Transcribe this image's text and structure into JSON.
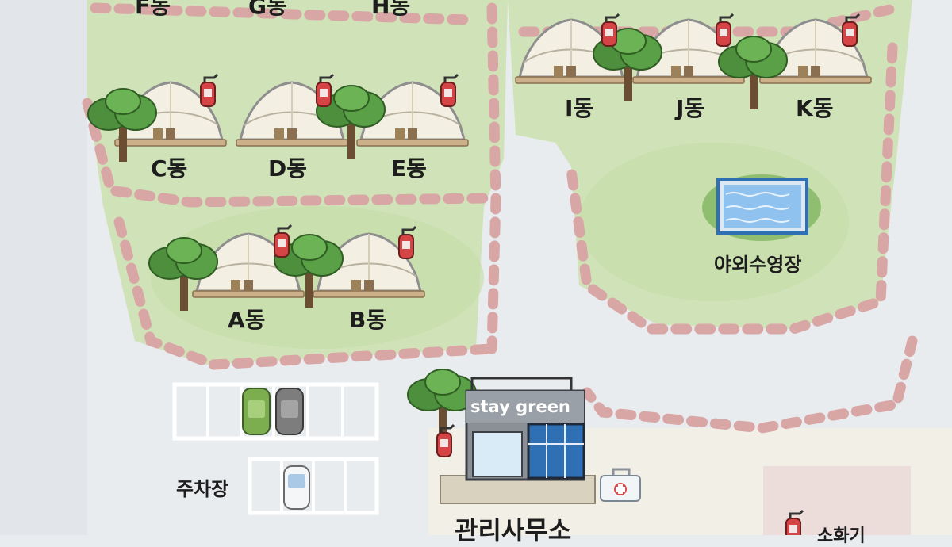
{
  "map": {
    "colors": {
      "grass": "#cfe3b4",
      "path": "#d9a6a6",
      "road": "#dfe3e8",
      "tent": "#f3efe2",
      "pool": "#5fa7e6",
      "tree": "#4d8f3c"
    },
    "sites": [
      {
        "id": "F",
        "label": "F동"
      },
      {
        "id": "G",
        "label": "G동"
      },
      {
        "id": "H",
        "label": "H동"
      },
      {
        "id": "C",
        "label": "C동"
      },
      {
        "id": "D",
        "label": "D동"
      },
      {
        "id": "E",
        "label": "E동"
      },
      {
        "id": "A",
        "label": "A동"
      },
      {
        "id": "B",
        "label": "B동"
      },
      {
        "id": "I",
        "label": "I동"
      },
      {
        "id": "J",
        "label": "J동"
      },
      {
        "id": "K",
        "label": "K동"
      }
    ],
    "pool": {
      "label": "야외수영장"
    },
    "parking": {
      "label": "주차장"
    },
    "office": {
      "label": "관리사무소",
      "sign": "stay green"
    },
    "legend": {
      "label": "소화기",
      "icon": "fire-extinguisher-icon"
    }
  }
}
